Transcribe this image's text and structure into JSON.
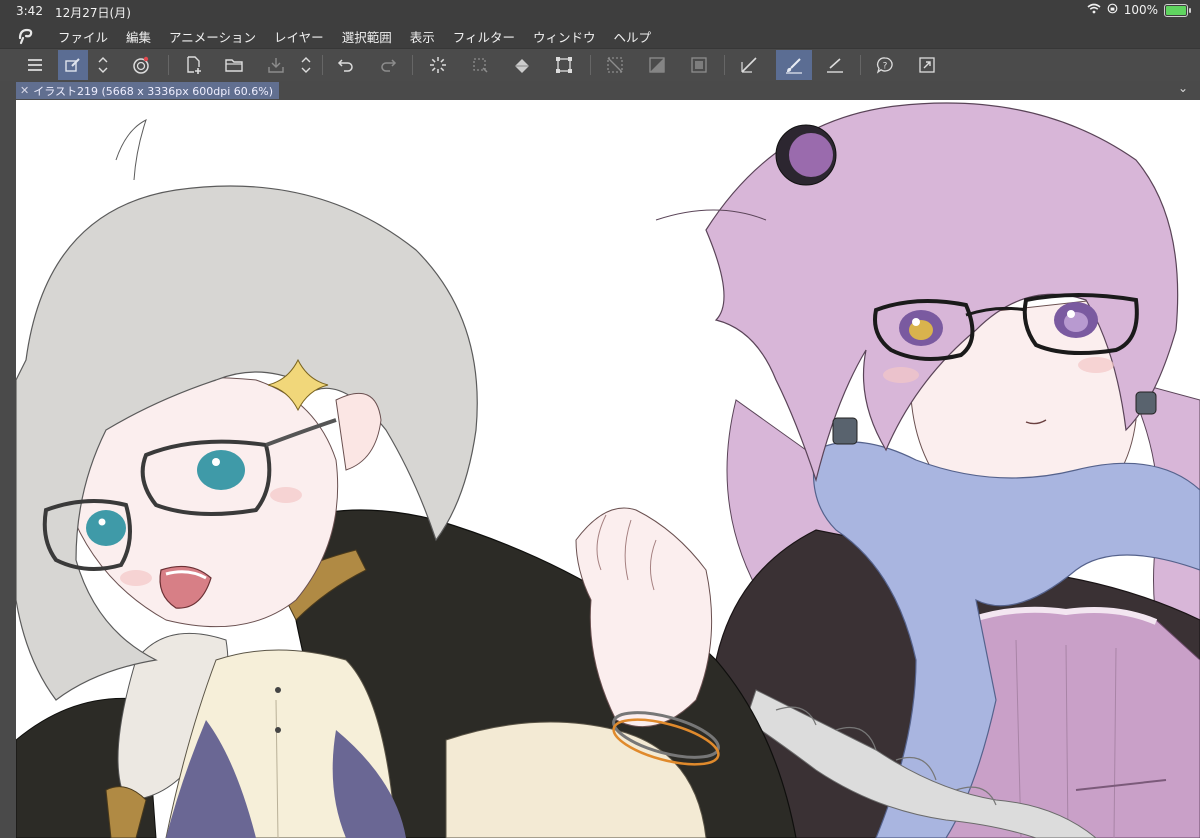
{
  "status": {
    "time": "3:42",
    "date": "12月27日(月)",
    "battery": "100%",
    "battery_level": 1.0
  },
  "menu": {
    "items": [
      "ファイル",
      "編集",
      "アニメーション",
      "レイヤー",
      "選択範囲",
      "表示",
      "フィルター",
      "ウィンドウ",
      "ヘルプ"
    ]
  },
  "toolbar": {
    "icons": [
      "menu-icon",
      "edit-icon",
      "up-down-icon",
      "clip-studio-icon",
      "new-canvas-icon",
      "open-folder-icon",
      "save-icon",
      "up-down-icon",
      "undo-icon",
      "redo-icon",
      "loading-icon",
      "transform-dim-icon",
      "fill-icon",
      "crop-icon",
      "clear-icon",
      "tone-icon",
      "frame-icon",
      "ruler-pen-icon",
      "brush-icon",
      "ruler-line-icon",
      "help-icon",
      "fullscreen-icon"
    ],
    "active_color": "#5b6d93"
  },
  "tab": {
    "label": "イラスト219 (5668 x 3336px 600dpi 60.6%)"
  },
  "colors": {
    "ui_bg": "#4a4a4a",
    "bar_bg": "#3e3e3e",
    "accent": "#5b6d93",
    "canvas_bg": "#ffffff"
  }
}
